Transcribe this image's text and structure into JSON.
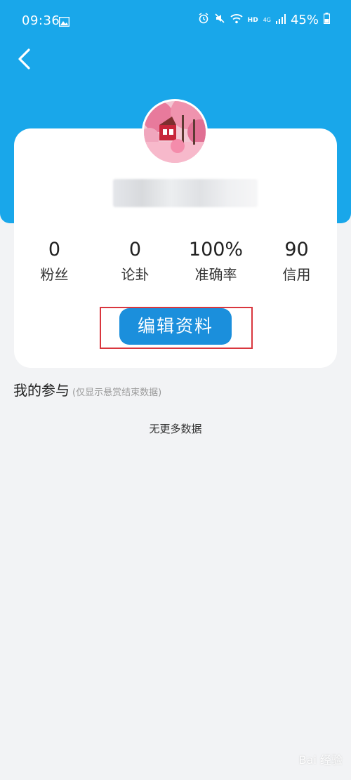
{
  "status_bar": {
    "time": "09:36",
    "icons": [
      "gallery-icon",
      "alarm-icon",
      "mute-icon",
      "wifi-icon",
      "hd-icon",
      "4g-icon",
      "signal-icon",
      "battery-icon"
    ],
    "hd_label": "HD",
    "network_label": "4G",
    "battery": "45%"
  },
  "header": {
    "back_icon": "chevron-left-icon",
    "color": "#19a7ea"
  },
  "profile": {
    "avatar": "profile-photo",
    "stats": [
      {
        "value": "0",
        "label": "粉丝"
      },
      {
        "value": "0",
        "label": "论卦"
      },
      {
        "value": "100%",
        "label": "准确率"
      },
      {
        "value": "90",
        "label": "信用"
      }
    ],
    "edit_button_label": "编辑资料",
    "button_color": "#1b8fdc",
    "highlight_color": "#d9363e"
  },
  "participation": {
    "title": "我的参与",
    "subtitle": "(仅显示悬赏结束数据)",
    "empty_text": "无更多数据"
  },
  "watermark": {
    "text": "Bai 经验"
  }
}
